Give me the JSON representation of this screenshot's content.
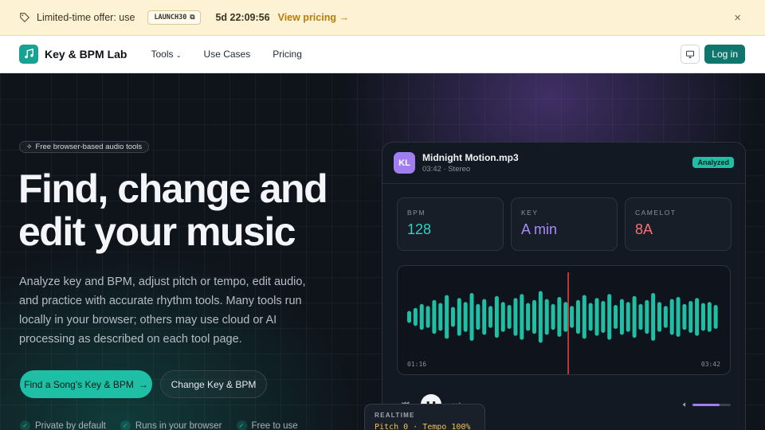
{
  "promo": {
    "text": "Limited-time offer: use",
    "code": "LAUNCH30",
    "countdown": "5d 22:09:56",
    "cta": "View pricing →",
    "close": "×"
  },
  "nav": {
    "brand": "Key & BPM Lab",
    "links": [
      "Tools",
      "Use Cases",
      "Pricing"
    ],
    "login": "Log in"
  },
  "hero": {
    "pill": "Free browser-based audio tools",
    "title": "Find, change and edit your music",
    "lead": "Analyze key and BPM, adjust pitch or tempo, edit audio, and practice with accurate rhythm tools. Many tools run locally in your browser; others may use cloud or AI processing as described on each tool page.",
    "cta_primary": "Find a Song's Key & BPM",
    "cta_secondary": "Change Key & BPM",
    "features": [
      "Private by default",
      "Runs in your browser",
      "Free to use"
    ]
  },
  "card": {
    "avatar": "KL",
    "file_name": "Midnight Motion.mp3",
    "file_meta": "03:42 · Stereo",
    "badge": "Analyzed",
    "stats": [
      {
        "label": "BPM",
        "value": "128",
        "color": "#2dd4bf"
      },
      {
        "label": "KEY",
        "value": "A min",
        "color": "#a78bfa"
      },
      {
        "label": "CAMELOT",
        "value": "8A",
        "color": "#f87171"
      }
    ],
    "time_current": "01:16",
    "time_total": "03:42",
    "playhead_fraction": 0.342,
    "volume_fraction": 0.7
  },
  "realtime": {
    "label": "REALTIME",
    "value": "Pitch 0 · Tempo 100%"
  },
  "colors": {
    "accent": "#1fbfa6",
    "purple": "#a17ef0",
    "promo_bg": "#fdf3d4",
    "playhead": "#ef4444"
  }
}
